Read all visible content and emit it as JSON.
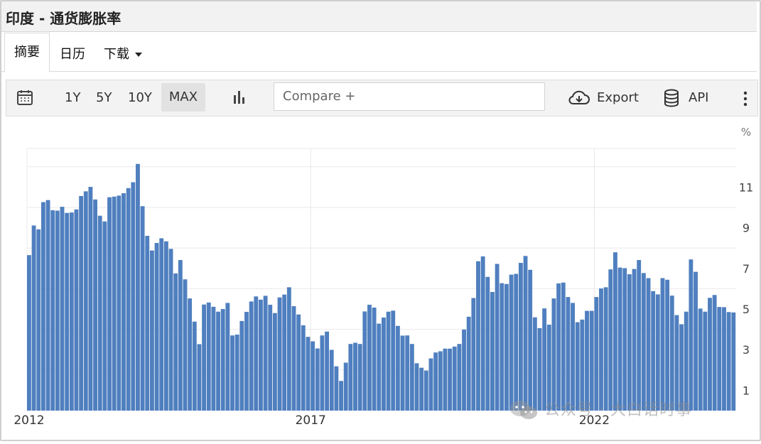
{
  "window": {
    "title": "印度 - 通货膨胀率"
  },
  "tabs": {
    "summary": "摘要",
    "calendar": "日历",
    "download": "下载"
  },
  "toolbar": {
    "range_1y": "1Y",
    "range_5y": "5Y",
    "range_10y": "10Y",
    "range_max": "MAX",
    "compare_placeholder": "Compare +",
    "export_label": "Export",
    "api_label": "API"
  },
  "watermark": {
    "text": "公众号 · 大白话时事"
  },
  "colors": {
    "bar": "#4f7fbf",
    "grid": "#e9e9e9"
  },
  "chart_data": {
    "type": "bar",
    "title": "",
    "unit": "%",
    "ylim": [
      0,
      12.9
    ],
    "y_ticks": [
      1,
      3,
      5,
      7,
      9,
      11
    ],
    "x_tick_labels": [
      {
        "label": "2012",
        "index": 0
      },
      {
        "label": "2017",
        "index": 60
      },
      {
        "label": "2022",
        "index": 120
      }
    ],
    "x_start": "2012-01",
    "frequency": "monthly",
    "grid": true,
    "values": [
      7.65,
      9.11,
      8.92,
      10.26,
      10.36,
      9.86,
      9.84,
      10.03,
      9.73,
      9.75,
      9.9,
      10.56,
      10.79,
      11.01,
      10.39,
      9.59,
      9.31,
      10.5,
      10.53,
      10.58,
      10.7,
      10.95,
      11.24,
      12.14,
      10.06,
      8.6,
      7.88,
      8.25,
      8.48,
      8.33,
      7.96,
      6.75,
      7.41,
      6.46,
      5.52,
      4.38,
      3.27,
      5.22,
      5.32,
      5.11,
      4.87,
      5.0,
      5.3,
      3.7,
      3.74,
      4.41,
      4.86,
      5.37,
      5.62,
      5.46,
      5.65,
      5.21,
      4.8,
      5.57,
      5.71,
      6.07,
      5.14,
      4.73,
      4.2,
      3.63,
      3.41,
      3.06,
      3.7,
      3.89,
      2.99,
      2.18,
      1.46,
      2.36,
      3.28,
      3.34,
      3.28,
      4.88,
      5.21,
      5.07,
      4.28,
      4.58,
      4.87,
      4.92,
      4.17,
      3.69,
      3.7,
      3.28,
      2.33,
      2.11,
      1.97,
      2.57,
      2.86,
      2.92,
      3.05,
      3.05,
      3.15,
      3.28,
      3.99,
      4.62,
      5.54,
      7.35,
      7.59,
      6.58,
      5.84,
      7.22,
      6.27,
      6.23,
      6.69,
      6.73,
      7.27,
      7.61,
      6.93,
      4.59,
      4.06,
      5.03,
      4.23,
      5.52,
      6.26,
      6.3,
      5.59,
      5.3,
      4.35,
      4.48,
      4.91,
      4.91,
      5.59,
      6.01,
      6.07,
      6.95,
      7.79,
      7.04,
      7.01,
      6.71,
      6.97,
      7.41,
      6.77,
      6.52,
      5.88,
      5.72,
      6.52,
      6.44,
      5.66,
      4.7,
      4.25,
      4.87,
      7.44,
      6.83,
      5.02,
      4.87,
      5.55,
      5.69,
      5.1,
      5.09,
      4.85,
      4.83
    ]
  }
}
